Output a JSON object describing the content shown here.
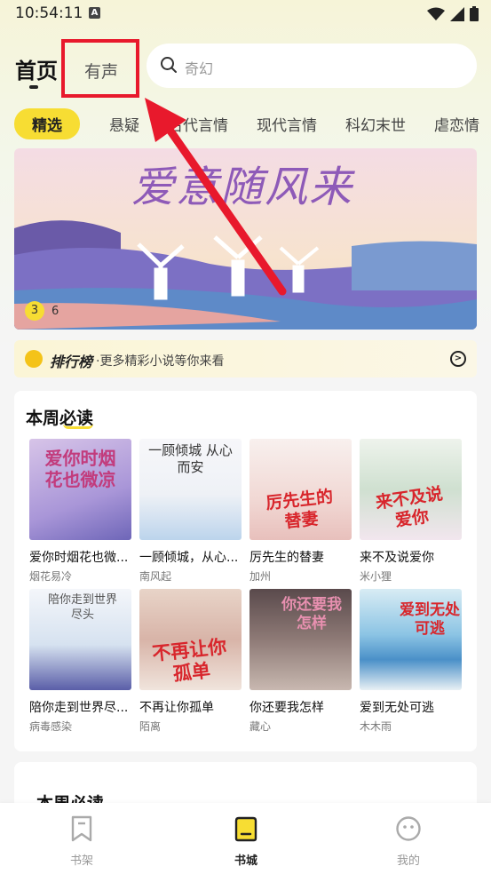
{
  "status_bar": {
    "time": "10:54:11",
    "badge": "A"
  },
  "header": {
    "home_label": "首页",
    "audio_label": "有声",
    "search_placeholder": "奇幻"
  },
  "categories": [
    "精选",
    "悬疑",
    "古代言情",
    "现代言情",
    "科幻末世",
    "虐恋情"
  ],
  "banner": {
    "title": "爱意随风来",
    "current_page": "3",
    "total_pages": "6"
  },
  "ranking": {
    "title": "排行榜",
    "subtitle": "·更多精彩小说等你来看"
  },
  "weekly": {
    "title": "本周必读",
    "books": [
      {
        "title": "爱你时烟花也微...",
        "author": "烟花易冷",
        "cover_text": "爱你时烟花也微凉"
      },
      {
        "title": "一顾倾城，从心...",
        "author": "南风起",
        "cover_text": "一顾倾城 从心而安"
      },
      {
        "title": "厉先生的替妻",
        "author": "加州",
        "cover_text": "厉先生的替妻"
      },
      {
        "title": "来不及说爱你",
        "author": "米小狸",
        "cover_text": "来不及说爱你"
      },
      {
        "title": "陪你走到世界尽...",
        "author": "病毒感染",
        "cover_text": "陪你走到世界尽头"
      },
      {
        "title": "不再让你孤单",
        "author": "陌离",
        "cover_text": "不再让你孤单"
      },
      {
        "title": "你还要我怎样",
        "author": "藏心",
        "cover_text": "你还要我怎样"
      },
      {
        "title": "爱到无处可逃",
        "author": "木木雨",
        "cover_text": "爱到无处可逃"
      }
    ]
  },
  "weekly2": {
    "title": "本周必读"
  },
  "bottom_nav": [
    {
      "label": "书架",
      "icon": "bookmark-icon"
    },
    {
      "label": "书城",
      "icon": "bookstore-icon"
    },
    {
      "label": "我的",
      "icon": "profile-icon"
    }
  ],
  "colors": {
    "accent": "#f7dd33",
    "annotation": "#e8192c"
  }
}
